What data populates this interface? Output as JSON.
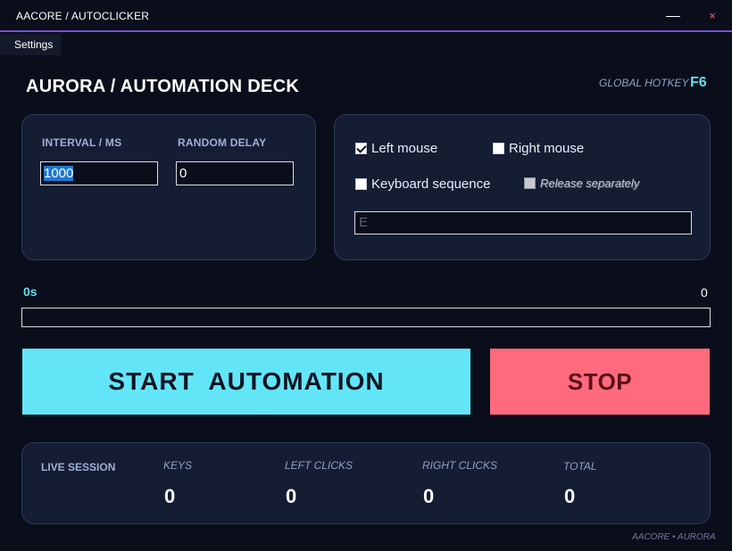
{
  "window": {
    "title": "AACORE  /  AUTOCLICKER",
    "minimize_icon": "minimize-icon",
    "close_icon": "close-icon",
    "close_glyph": "×"
  },
  "menu": {
    "settings_label": "Settings"
  },
  "header": {
    "title": "AURORA  /  AUTOMATION DECK",
    "hotkey_label": "GLOBAL HOTKEY",
    "hotkey_key": "F6"
  },
  "interval_panel": {
    "interval_label": "INTERVAL / MS",
    "interval_value": "1000",
    "random_delay_label": "RANDOM DELAY",
    "random_delay_value": "0"
  },
  "input_panel": {
    "left_mouse": {
      "label": "Left mouse",
      "checked": true
    },
    "right_mouse": {
      "label": "Right mouse",
      "checked": false
    },
    "keyboard_sequence": {
      "label": "Keyboard sequence",
      "checked": false
    },
    "release_separately": {
      "label": "Release separately",
      "checked": false,
      "disabled": true
    },
    "key_sequence_value": "E"
  },
  "timer": {
    "elapsed": "0s",
    "count": "0",
    "progress": 0
  },
  "actions": {
    "start_label": "START  AUTOMATION",
    "stop_label": "STOP"
  },
  "live_session": {
    "title": "LIVE SESSION",
    "stats": [
      {
        "label": "KEYS",
        "value": "0"
      },
      {
        "label": "LEFT CLICKS",
        "value": "0"
      },
      {
        "label": "RIGHT CLICKS",
        "value": "0"
      },
      {
        "label": "TOTAL",
        "value": "0"
      }
    ]
  },
  "footer": {
    "text": "AACORE • AURORA"
  },
  "colors": {
    "background": "#0a0e1a",
    "panel": "#151d33",
    "accent_cyan": "#62e6f7",
    "accent_red": "#ff6b7d",
    "titlebar_border": "#7a4fd8"
  }
}
